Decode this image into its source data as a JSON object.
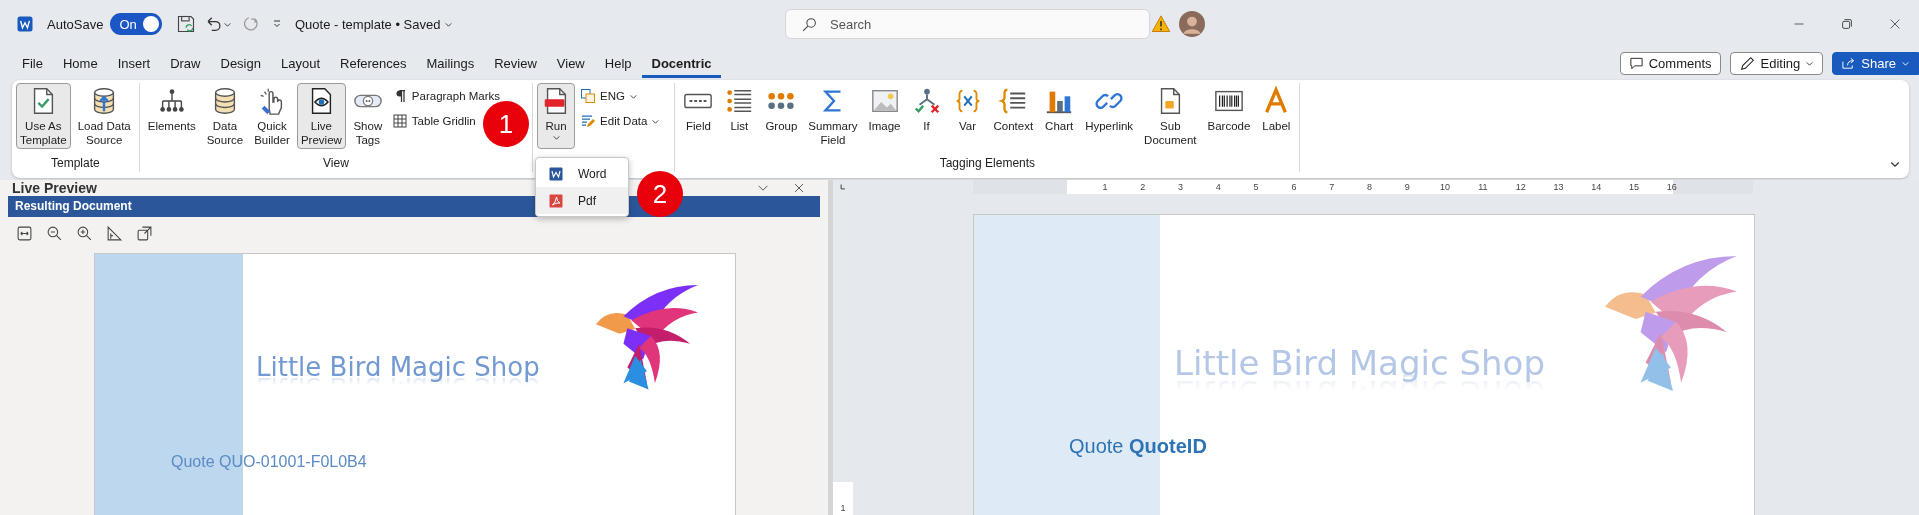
{
  "title_bar": {
    "autosave_label": "AutoSave",
    "autosave_toggle": {
      "label": "On",
      "on": true
    },
    "document_title": "Quote - template • Saved",
    "search": {
      "placeholder": "Search"
    }
  },
  "menu_tabs": [
    {
      "label": "File",
      "selected": false
    },
    {
      "label": "Home",
      "selected": false
    },
    {
      "label": "Insert",
      "selected": false
    },
    {
      "label": "Draw",
      "selected": false
    },
    {
      "label": "Design",
      "selected": false
    },
    {
      "label": "Layout",
      "selected": false
    },
    {
      "label": "References",
      "selected": false
    },
    {
      "label": "Mailings",
      "selected": false
    },
    {
      "label": "Review",
      "selected": false
    },
    {
      "label": "View",
      "selected": false
    },
    {
      "label": "Help",
      "selected": false
    },
    {
      "label": "Docentric",
      "selected": true
    }
  ],
  "header_buttons": [
    {
      "kind": "comments",
      "label": "Comments"
    },
    {
      "kind": "editing",
      "label": "Editing"
    },
    {
      "kind": "share",
      "label": "Share"
    }
  ],
  "ribbon": {
    "groups": [
      {
        "label": "Template",
        "items": [
          {
            "kind": "large",
            "label": "Use As\nTemplate",
            "selected": true,
            "dropdown": false
          },
          {
            "kind": "large",
            "label": "Load Data\nSource",
            "selected": false,
            "dropdown": false
          }
        ]
      },
      {
        "label": "View",
        "items": [
          {
            "kind": "large",
            "label": "Elements",
            "selected": false,
            "dropdown": false
          },
          {
            "kind": "large",
            "label": "Data\nSource",
            "selected": false,
            "dropdown": false
          },
          {
            "kind": "large",
            "label": "Quick\nBuilder",
            "selected": false,
            "dropdown": false
          },
          {
            "kind": "large",
            "label": "Live\nPreview",
            "selected": true,
            "dropdown": false
          },
          {
            "kind": "large",
            "label": "Show\nTags",
            "selected": false,
            "dropdown": false
          },
          {
            "kind": "stack",
            "items": [
              {
                "label": "Paragraph Marks",
                "dropdown": false
              },
              {
                "label": "Table Gridlin",
                "dropdown": false
              }
            ]
          }
        ]
      },
      {
        "items": [
          {
            "kind": "large",
            "label": "Run",
            "selected": true,
            "dropdown": true
          },
          {
            "kind": "stack",
            "items": [
              {
                "label": "ENG",
                "dropdown": true
              },
              {
                "label": "Edit Data",
                "dropdown": true
              }
            ]
          }
        ]
      },
      {
        "label": "Tagging Elements",
        "items": [
          {
            "kind": "large",
            "label": "Field",
            "selected": false,
            "dropdown": false
          },
          {
            "kind": "large",
            "label": "List",
            "selected": false,
            "dropdown": false
          },
          {
            "kind": "large",
            "label": "Group",
            "selected": false,
            "dropdown": false
          },
          {
            "kind": "large",
            "label": "Summary\nField",
            "selected": false,
            "dropdown": false
          },
          {
            "kind": "large",
            "label": "Image",
            "selected": false,
            "dropdown": false
          },
          {
            "kind": "large",
            "label": "If",
            "selected": false,
            "dropdown": false
          },
          {
            "kind": "large",
            "label": "Var",
            "selected": false,
            "dropdown": false
          },
          {
            "kind": "large",
            "label": "Context",
            "selected": false,
            "dropdown": false
          },
          {
            "kind": "large",
            "label": "Chart",
            "selected": false,
            "dropdown": false
          },
          {
            "kind": "large",
            "label": "Hyperlink",
            "selected": false,
            "dropdown": false
          },
          {
            "kind": "large",
            "label": "Sub\nDocument",
            "selected": false,
            "dropdown": false
          },
          {
            "kind": "large",
            "label": "Barcode",
            "selected": false,
            "dropdown": false
          },
          {
            "kind": "large",
            "label": "Label",
            "selected": false,
            "dropdown": false
          }
        ]
      }
    ]
  },
  "run_menu": {
    "items": [
      {
        "label": "Word",
        "selected": false
      },
      {
        "label": "Pdf",
        "selected": true
      }
    ]
  },
  "callouts": [
    {
      "label": "1"
    },
    {
      "label": "2"
    }
  ],
  "live_preview": {
    "title": "Live Preview",
    "tab": "Resulting Document",
    "document": {
      "heading": "Little Bird Magic Shop",
      "quote": "Quote QUO-01001-F0L0B4"
    }
  },
  "editor": {
    "ruler": {
      "labels": [
        "1",
        "2",
        "3",
        "4",
        "5",
        "6",
        "7",
        "8",
        "9",
        "10",
        "11",
        "12",
        "13",
        "14",
        "15",
        "16"
      ]
    },
    "vertical_ruler": {
      "labels": [
        "1"
      ]
    },
    "document": {
      "heading": "Little Bird Magic Shop",
      "quote": "Quote **QuoteID**"
    }
  }
}
